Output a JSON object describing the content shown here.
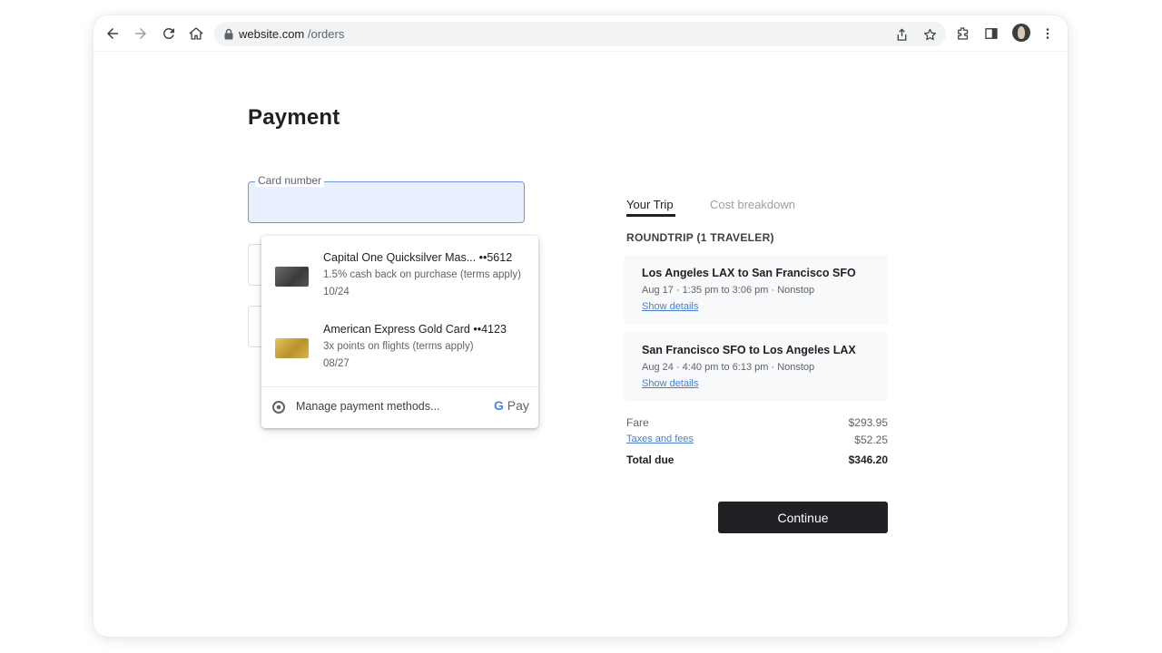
{
  "browser": {
    "url_host": "website.com",
    "url_path": "/orders"
  },
  "page": {
    "title": "Payment"
  },
  "card_field": {
    "label": "Card number",
    "value": ""
  },
  "autofill": {
    "cards": [
      {
        "name": "Capital One Quicksilver Mas... ••5612",
        "benefit": "1.5% cash back on purchase (terms apply)",
        "expiry": "10/24",
        "card_color": "#4a4a4a"
      },
      {
        "name": "American Express Gold Card ••4123",
        "benefit": "3x points on flights (terms apply)",
        "expiry": "08/27",
        "card_color": "#c9a43c"
      }
    ],
    "manage_label": "Manage payment methods...",
    "pay_brand": "Pay"
  },
  "trip": {
    "tabs": [
      {
        "label": "Your Trip",
        "active": true
      },
      {
        "label": "Cost breakdown",
        "active": false
      }
    ],
    "heading": "ROUNDTRIP (1 TRAVELER)",
    "legs": [
      {
        "route": "Los Angeles LAX to San Francisco SFO",
        "time": "Aug 17 · 1:35 pm to 3:06 pm · Nonstop",
        "link": "Show details"
      },
      {
        "route": "San Francisco SFO to Los Angeles LAX",
        "time": "Aug 24 · 4:40 pm to 6:13 pm · Nonstop",
        "link": "Show details"
      }
    ],
    "costs": {
      "fare_label": "Fare",
      "fare_value": "$293.95",
      "taxes_label": "Taxes and fees",
      "taxes_value": "$52.25",
      "total_label": "Total due",
      "total_value": "$346.20"
    }
  },
  "actions": {
    "continue_label": "Continue"
  },
  "colors": {
    "accent_link": "#4a7fd0",
    "field_focus_border": "#6e96e0",
    "field_autofill_bg": "#e8f0fe",
    "button_bg": "#202124"
  }
}
